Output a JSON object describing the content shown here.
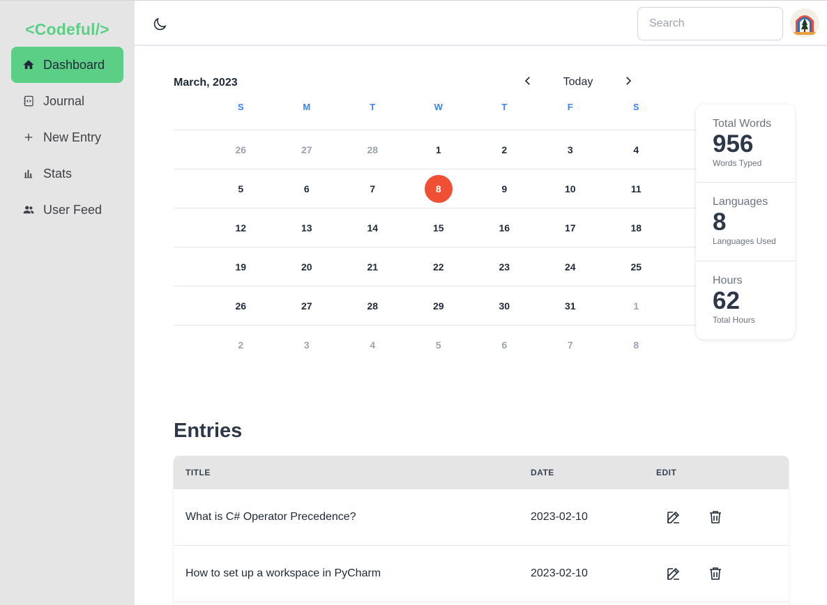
{
  "sidebar": {
    "logo": "<Codeful/>",
    "items": [
      {
        "label": "Dashboard",
        "icon": "home-icon",
        "active": true
      },
      {
        "label": "Journal",
        "icon": "journal-code-icon",
        "active": false
      },
      {
        "label": "New Entry",
        "icon": "plus-icon",
        "active": false
      },
      {
        "label": "Stats",
        "icon": "bar-chart-icon",
        "active": false
      },
      {
        "label": "User Feed",
        "icon": "users-icon",
        "active": false
      }
    ]
  },
  "topbar": {
    "theme_icon": "moon-icon",
    "search_placeholder": "Search",
    "avatar_icon": "user-avatar"
  },
  "calendar": {
    "month_label": "March, 2023",
    "today_label": "Today",
    "weekdays": [
      "S",
      "M",
      "T",
      "W",
      "T",
      "F",
      "S"
    ],
    "weeks": [
      [
        {
          "d": "26",
          "o": true
        },
        {
          "d": "27",
          "o": true
        },
        {
          "d": "28",
          "o": true
        },
        {
          "d": "1"
        },
        {
          "d": "2"
        },
        {
          "d": "3"
        },
        {
          "d": "4"
        }
      ],
      [
        {
          "d": "5"
        },
        {
          "d": "6"
        },
        {
          "d": "7"
        },
        {
          "d": "8",
          "today": true
        },
        {
          "d": "9"
        },
        {
          "d": "10"
        },
        {
          "d": "11"
        }
      ],
      [
        {
          "d": "12"
        },
        {
          "d": "13"
        },
        {
          "d": "14"
        },
        {
          "d": "15"
        },
        {
          "d": "16"
        },
        {
          "d": "17"
        },
        {
          "d": "18"
        }
      ],
      [
        {
          "d": "19"
        },
        {
          "d": "20"
        },
        {
          "d": "21"
        },
        {
          "d": "22"
        },
        {
          "d": "23"
        },
        {
          "d": "24"
        },
        {
          "d": "25"
        }
      ],
      [
        {
          "d": "26"
        },
        {
          "d": "27"
        },
        {
          "d": "28"
        },
        {
          "d": "29"
        },
        {
          "d": "30"
        },
        {
          "d": "31"
        },
        {
          "d": "1",
          "o": true
        }
      ],
      [
        {
          "d": "2",
          "o": true
        },
        {
          "d": "3",
          "o": true
        },
        {
          "d": "4",
          "o": true
        },
        {
          "d": "5",
          "o": true
        },
        {
          "d": "6",
          "o": true
        },
        {
          "d": "7",
          "o": true
        },
        {
          "d": "8",
          "o": true
        }
      ]
    ],
    "today_color": "#ef4f33",
    "weekday_color": "#3b82f6"
  },
  "stats": [
    {
      "title": "Total Words",
      "value": "956",
      "desc": "Words Typed"
    },
    {
      "title": "Languages",
      "value": "8",
      "desc": "Languages Used"
    },
    {
      "title": "Hours",
      "value": "62",
      "desc": "Total Hours"
    }
  ],
  "entries": {
    "heading": "Entries",
    "columns": {
      "title": "TITLE",
      "date": "DATE",
      "edit": "EDIT"
    },
    "rows": [
      {
        "title": "What is C# Operator Precedence?",
        "date": "2023-02-10"
      },
      {
        "title": "How to set up a workspace in PyCharm",
        "date": "2023-02-10"
      }
    ]
  },
  "colors": {
    "accent": "#5ccf86",
    "sidebar_bg": "#e5e5e5"
  }
}
